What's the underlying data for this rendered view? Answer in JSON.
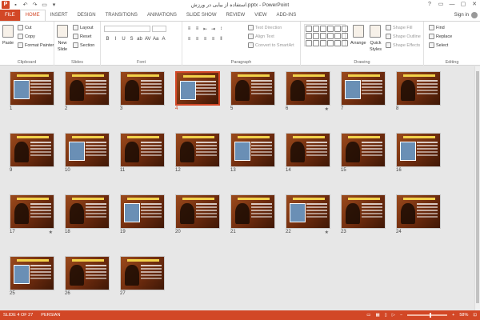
{
  "window": {
    "app_icon": "P",
    "title": "استفاده از بیایی در ورزش.pptx - PowerPoint",
    "controls": [
      "?",
      "▭",
      "—",
      "▢",
      "✕"
    ]
  },
  "tabs": [
    "FILE",
    "HOME",
    "INSERT",
    "DESIGN",
    "TRANSITIONS",
    "ANIMATIONS",
    "SLIDE SHOW",
    "REVIEW",
    "VIEW",
    "ADD-INS"
  ],
  "active_tab": "HOME",
  "sign_in": "Sign in",
  "ribbon": {
    "clipboard": {
      "label": "Clipboard",
      "paste": "Paste",
      "cut": "Cut",
      "copy": "Copy",
      "format_painter": "Format Painter"
    },
    "slides": {
      "label": "Slides",
      "new_slide_1": "New",
      "new_slide_2": "Slide",
      "layout": "Layout",
      "reset": "Reset",
      "section": "Section"
    },
    "font": {
      "label": "Font"
    },
    "paragraph": {
      "label": "Paragraph",
      "text_direction": "Text Direction",
      "align_text": "Align Text",
      "convert_smartart": "Convert to SmartArt"
    },
    "drawing": {
      "label": "Drawing",
      "arrange": "Arrange",
      "quick_styles_1": "Quick",
      "quick_styles_2": "Styles",
      "shape_fill": "Shape Fill",
      "shape_outline": "Shape Outline",
      "shape_effects": "Shape Effects"
    },
    "editing": {
      "label": "Editing",
      "find": "Find",
      "replace": "Replace",
      "select": "Select"
    }
  },
  "slides": [
    {
      "n": "1",
      "star": ""
    },
    {
      "n": "2",
      "star": ""
    },
    {
      "n": "3",
      "star": ""
    },
    {
      "n": "4",
      "star": "",
      "selected": true
    },
    {
      "n": "5",
      "star": ""
    },
    {
      "n": "6",
      "star": "★"
    },
    {
      "n": "7",
      "star": ""
    },
    {
      "n": "8",
      "star": ""
    },
    {
      "n": "9",
      "star": ""
    },
    {
      "n": "10",
      "star": ""
    },
    {
      "n": "11",
      "star": ""
    },
    {
      "n": "12",
      "star": ""
    },
    {
      "n": "13",
      "star": ""
    },
    {
      "n": "14",
      "star": ""
    },
    {
      "n": "15",
      "star": ""
    },
    {
      "n": "16",
      "star": ""
    },
    {
      "n": "17",
      "star": "★"
    },
    {
      "n": "18",
      "star": ""
    },
    {
      "n": "19",
      "star": ""
    },
    {
      "n": "20",
      "star": ""
    },
    {
      "n": "21",
      "star": ""
    },
    {
      "n": "22",
      "star": "★"
    },
    {
      "n": "23",
      "star": ""
    },
    {
      "n": "24",
      "star": ""
    },
    {
      "n": "25",
      "star": ""
    },
    {
      "n": "26",
      "star": ""
    },
    {
      "n": "27",
      "star": ""
    }
  ],
  "status": {
    "slide": "SLIDE 4 OF 27",
    "language": "PERSIAN",
    "zoom": "58%"
  },
  "colors": {
    "accent": "#d24726"
  }
}
